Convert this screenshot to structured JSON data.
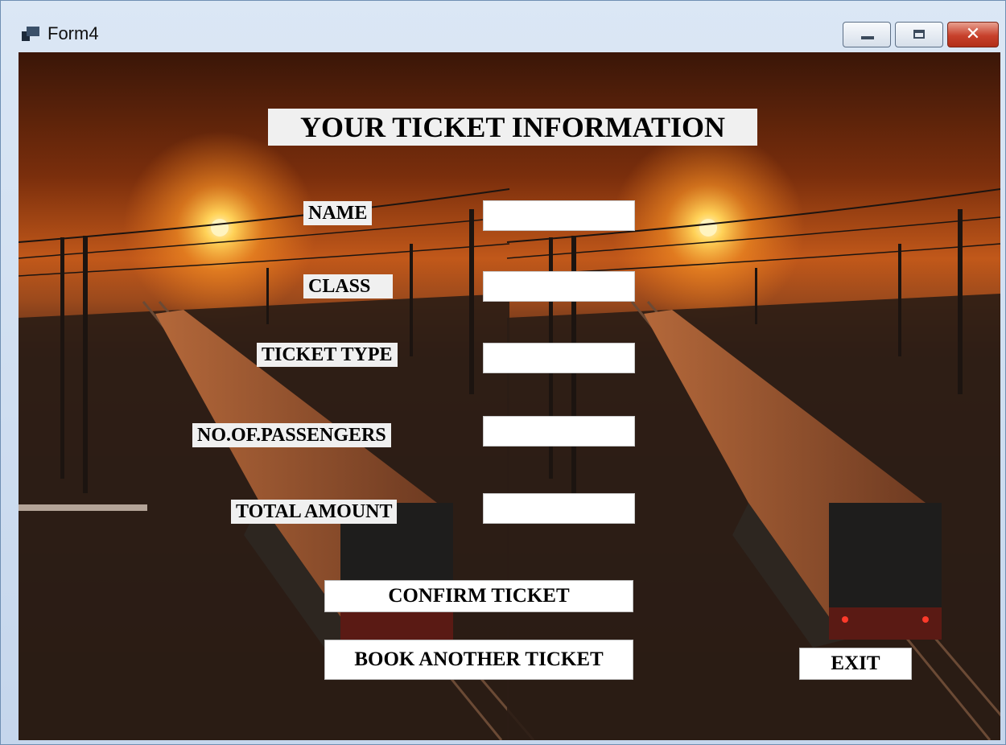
{
  "window": {
    "title": "Form4",
    "icon": "form-window-icon",
    "controls": {
      "minimize": "minimize-icon",
      "maximize": "maximize-icon",
      "close": "close-icon",
      "close_glyph": "✕"
    }
  },
  "form": {
    "heading": "YOUR TICKET INFORMATION",
    "fields": [
      {
        "label": "NAME",
        "value": ""
      },
      {
        "label": "CLASS",
        "value": ""
      },
      {
        "label": "TICKET TYPE",
        "value": ""
      },
      {
        "label": "NO.OF.PASSENGERS",
        "value": ""
      },
      {
        "label": "TOTAL AMOUNT",
        "value": ""
      }
    ]
  },
  "buttons": {
    "confirm": "CONFIRM TICKET",
    "book_another": "BOOK ANOTHER TICKET",
    "exit": "EXIT"
  },
  "colors": {
    "sky_top": "#3a1608",
    "sun_glow": "#e8771c",
    "ground": "#2a1c15",
    "label_bg": "#f0f0f0",
    "close_button": "#c7402b"
  }
}
